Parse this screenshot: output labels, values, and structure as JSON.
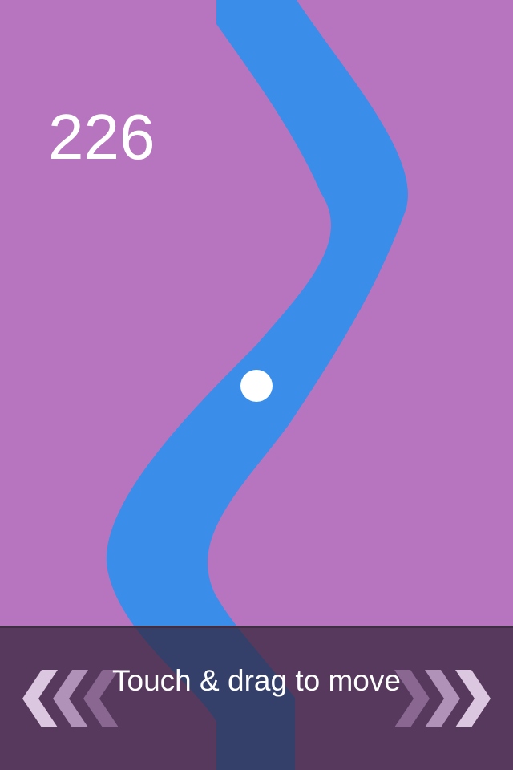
{
  "game": {
    "score": "226",
    "hint": "Touch & drag to move",
    "colors": {
      "background": "#b875bf",
      "path": "#3a8de8",
      "ball": "#ffffff",
      "hint_bar": "#322337"
    },
    "icons": {
      "left": "chevrons-left-icon",
      "right": "chevrons-right-icon"
    }
  }
}
